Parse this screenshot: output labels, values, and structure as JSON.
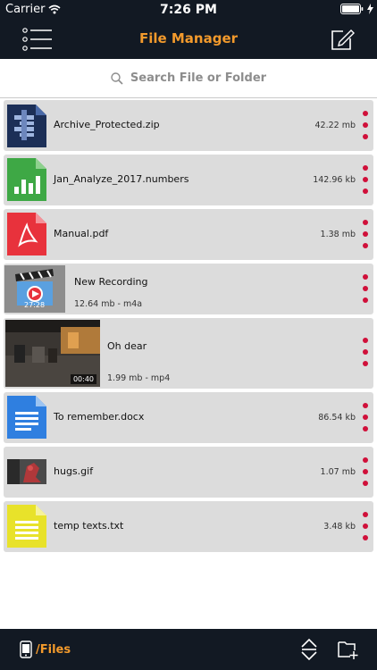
{
  "status_bar": {
    "carrier": "Carrier",
    "time": "7:26 PM"
  },
  "nav": {
    "title": "File Manager"
  },
  "search": {
    "placeholder": "Search File or Folder"
  },
  "files": [
    {
      "name": "Archive_Protected.zip",
      "size": "42.22 mb",
      "icon": "zip-archive-icon"
    },
    {
      "name": "Jan_Analyze_2017.numbers",
      "size": "142.96 kb",
      "icon": "numbers-chart-icon"
    },
    {
      "name": "Manual.pdf",
      "size": "1.38 mb",
      "icon": "pdf-icon"
    },
    {
      "name": "New Recording",
      "meta": "12.64 mb - m4a",
      "duration": "27:28",
      "icon": "video-clapper-icon"
    },
    {
      "name": "Oh dear",
      "meta": "1.99 mb - mp4",
      "duration": "00:40",
      "icon": "video-thumbnail"
    },
    {
      "name": "To remember.docx",
      "size": "86.54 kb",
      "icon": "doc-icon"
    },
    {
      "name": "hugs.gif",
      "size": "1.07 mb",
      "icon": "gif-thumbnail"
    },
    {
      "name": "temp texts.txt",
      "size": "3.48 kb",
      "icon": "txt-icon"
    }
  ],
  "toolbar": {
    "path": "/Files"
  },
  "colors": {
    "bar": "#121923",
    "accent": "#f39a2c",
    "dot": "#d0103a",
    "row": "#dcdcdc"
  }
}
